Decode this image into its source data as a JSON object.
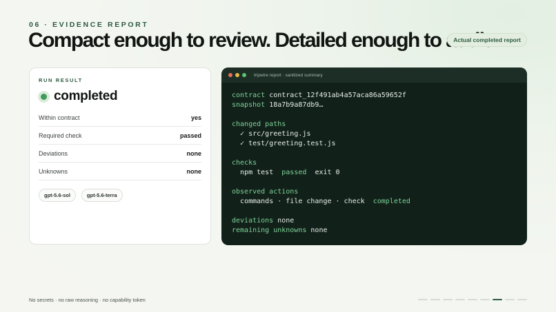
{
  "header": {
    "kicker": "06 · EVIDENCE REPORT",
    "title": "Compact enough to review. Detailed enough to audit.",
    "badge": "Actual completed report"
  },
  "run_card": {
    "label": "RUN RESULT",
    "status": "completed",
    "rows": [
      {
        "label": "Within contract",
        "value": "yes"
      },
      {
        "label": "Required check",
        "value": "passed"
      },
      {
        "label": "Deviations",
        "value": "none"
      },
      {
        "label": "Unknowns",
        "value": "none"
      }
    ],
    "chips": [
      "gpt-5.6-sol",
      "gpt-5.6-terra"
    ]
  },
  "terminal": {
    "title": "tripwire report · sanitized summary",
    "contract_key": "contract",
    "contract_value": "contract_12f491ab4a57aca86a59652f",
    "snapshot_key": "snapshot",
    "snapshot_value": "18a7b9a87db9…",
    "changed_paths_key": "changed paths",
    "changed_paths": [
      "✓ src/greeting.js",
      "✓ test/greeting.test.js"
    ],
    "checks_key": "checks",
    "check_cmd": "npm test",
    "check_status": "passed",
    "check_exit": "exit 0",
    "observed_key": "observed actions",
    "observed_value": "commands · file change · check",
    "observed_status": "completed",
    "deviations_key": "deviations",
    "deviations_value": "none",
    "unknowns_key": "remaining unknowns",
    "unknowns_value": "none"
  },
  "footer": {
    "note": "No secrets · no raw reasoning · no capability token",
    "progress_total": 9,
    "progress_current": 7
  },
  "colors": {
    "accent": "#2c5a3f",
    "terminal_bg": "#11211a",
    "terminal_keyword": "#7fd197",
    "status_green": "#3f9a5c",
    "window_red": "#e8705a",
    "window_yellow": "#e6b84a",
    "window_green": "#5cc46f"
  }
}
